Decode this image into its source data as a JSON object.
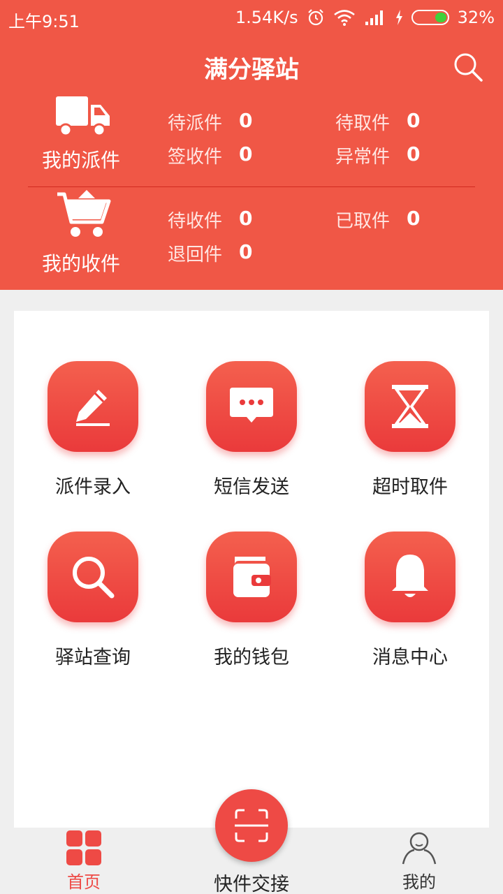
{
  "status_bar": {
    "time": "上午9:51",
    "speed": "1.54K/s",
    "battery": "32%"
  },
  "header": {
    "title": "满分驿站",
    "dispatch": {
      "label": "我的派件",
      "stats": [
        {
          "label": "待派件",
          "value": "0"
        },
        {
          "label": "待取件",
          "value": "0"
        },
        {
          "label": "签收件",
          "value": "0"
        },
        {
          "label": "异常件",
          "value": "0"
        }
      ]
    },
    "receive": {
      "label": "我的收件",
      "stats": [
        {
          "label": "待收件",
          "value": "0"
        },
        {
          "label": "已取件",
          "value": "0"
        },
        {
          "label": "退回件",
          "value": "0"
        }
      ]
    }
  },
  "grid": [
    {
      "label": "派件录入",
      "icon": "pencil-icon"
    },
    {
      "label": "短信发送",
      "icon": "message-icon"
    },
    {
      "label": "超时取件",
      "icon": "hourglass-icon"
    },
    {
      "label": "驿站查询",
      "icon": "search-icon"
    },
    {
      "label": "我的钱包",
      "icon": "wallet-icon"
    },
    {
      "label": "消息中心",
      "icon": "bell-icon"
    }
  ],
  "bottom_nav": {
    "home": "首页",
    "center": "快件交接",
    "mine": "我的"
  },
  "colors": {
    "primary": "#f05746",
    "accent": "#ea3a3b",
    "nav_active": "#ee4a45",
    "nav_inactive": "#333333"
  }
}
